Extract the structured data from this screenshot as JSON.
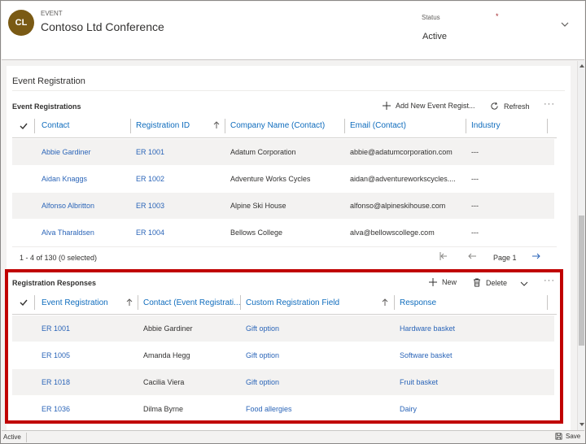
{
  "header": {
    "avatar_initials": "CL",
    "entity_type": "EVENT",
    "entity_name": "Contoso Ltd Conference",
    "status_label": "Status",
    "required_marker": "*",
    "status_value": "Active"
  },
  "section": {
    "title": "Event Registration"
  },
  "registrations": {
    "title": "Event Registrations",
    "add_label": "Add New Event Regist...",
    "refresh_label": "Refresh",
    "more_label": "···",
    "columns": [
      "Contact",
      "Registration ID",
      "Company Name (Contact)",
      "Email (Contact)",
      "Industry"
    ],
    "rows": [
      {
        "contact": "Abbie Gardiner",
        "id": "ER 1001",
        "company": "Adatum Corporation",
        "email": "abbie@adatumcorporation.com",
        "industry": "---"
      },
      {
        "contact": "Aidan Knaggs",
        "id": "ER 1002",
        "company": "Adventure Works Cycles",
        "email": "aidan@adventureworkscycles....",
        "industry": "---"
      },
      {
        "contact": "Alfonso Albritton",
        "id": "ER 1003",
        "company": "Alpine Ski House",
        "email": "alfonso@alpineskihouse.com",
        "industry": "---"
      },
      {
        "contact": "Alva Tharaldsen",
        "id": "ER 1004",
        "company": "Bellows College",
        "email": "alva@bellowscollege.com",
        "industry": "---"
      }
    ],
    "pager": {
      "summary": "1 - 4 of 130 (0 selected)",
      "page_label": "Page 1"
    }
  },
  "responses": {
    "title": "Registration Responses",
    "new_label": "New",
    "delete_label": "Delete",
    "more_label": "···",
    "columns": [
      "Event Registration",
      "Contact (Event Registrati...",
      "Custom Registration Field",
      "Response"
    ],
    "rows": [
      {
        "registration": "ER 1001",
        "contact": "Abbie Gardiner",
        "field": "Gift option",
        "response": "Hardware basket"
      },
      {
        "registration": "ER 1005",
        "contact": "Amanda Hegg",
        "field": "Gift option",
        "response": "Software basket"
      },
      {
        "registration": "ER 1018",
        "contact": "Cacilia Viera",
        "field": "Gift option",
        "response": "Fruit basket"
      },
      {
        "registration": "ER 1036",
        "contact": "Dilma Byrne",
        "field": "Food allergies",
        "response": "Dairy"
      }
    ]
  },
  "statusbar": {
    "state": "Active",
    "save_label": "Save"
  },
  "colors": {
    "avatar": "#7a5a14",
    "link": "#2b65b8",
    "highlight": "#c00000",
    "required": "#a4262c"
  },
  "icons": [
    "chevron-down-icon",
    "plus-icon",
    "refresh-icon",
    "checkmark-icon",
    "sort-up-icon",
    "first-page-icon",
    "previous-page-icon",
    "next-page-icon",
    "trash-icon",
    "save-icon"
  ]
}
